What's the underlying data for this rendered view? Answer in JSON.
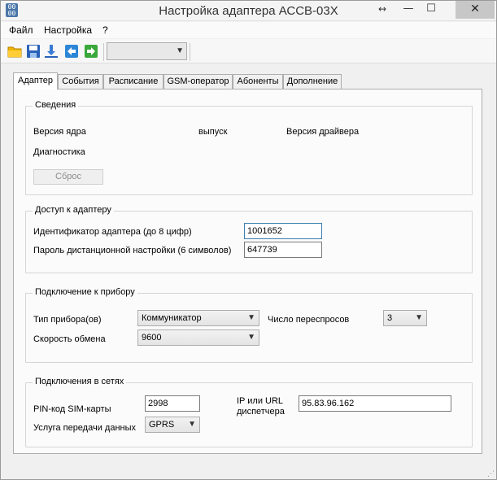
{
  "window": {
    "title": "Настройка адаптера АССВ-03Х",
    "icon_text": "00\n00",
    "resize_glyph": "↔",
    "minimize_glyph": "—",
    "maximize_glyph": "☐",
    "close_glyph": "✕"
  },
  "menu": {
    "items": [
      "Файл",
      "Настройка",
      "?"
    ]
  },
  "toolbar": {
    "icons": [
      "open-folder-icon",
      "save-icon",
      "download-icon",
      "back-arrow-icon",
      "forward-arrow-icon"
    ],
    "combo_value": ""
  },
  "tabs": [
    {
      "label": "Адаптер",
      "active": true
    },
    {
      "label": "События",
      "active": false
    },
    {
      "label": "Расписание",
      "active": false
    },
    {
      "label": "GSM-оператор",
      "active": false
    },
    {
      "label": "Абоненты",
      "active": false
    },
    {
      "label": "Дополнение",
      "active": false
    }
  ],
  "info": {
    "title": "Сведения",
    "core_version_label": "Версия ядра",
    "release_label": "выпуск",
    "driver_version_label": "Версия драйвера",
    "diagnostics_label": "Диагностика",
    "reset_button": "Сброс"
  },
  "access": {
    "title": "Доступ к адаптеру",
    "adapter_id_label": "Идентификатор адаптера (до 8 цифр)",
    "adapter_id_value": "1001652",
    "password_label": "Пароль дистанционной настройки (6 символов)",
    "password_value": "647739"
  },
  "device": {
    "title": "Подключение к прибору",
    "type_label": "Тип прибора(ов)",
    "type_value": "Коммуникатор",
    "retries_label": "Число переспросов",
    "retries_value": "3",
    "speed_label": "Скорость обмена",
    "speed_value": "9600"
  },
  "network": {
    "title": "Подключения в сетях",
    "pin_label": "PIN-код SIM-карты",
    "pin_value": "2998",
    "service_label": "Услуга передачи данных",
    "service_value": "GPRS",
    "ip_label_line1": "IP или URL",
    "ip_label_line2": "диспетчера",
    "ip_value": "95.83.96.162"
  },
  "colors": {
    "folder": "#f0b400",
    "save": "#2a62b8",
    "download": "#3a7bd5",
    "back": "#2c86d8",
    "forward": "#3aa83a"
  }
}
